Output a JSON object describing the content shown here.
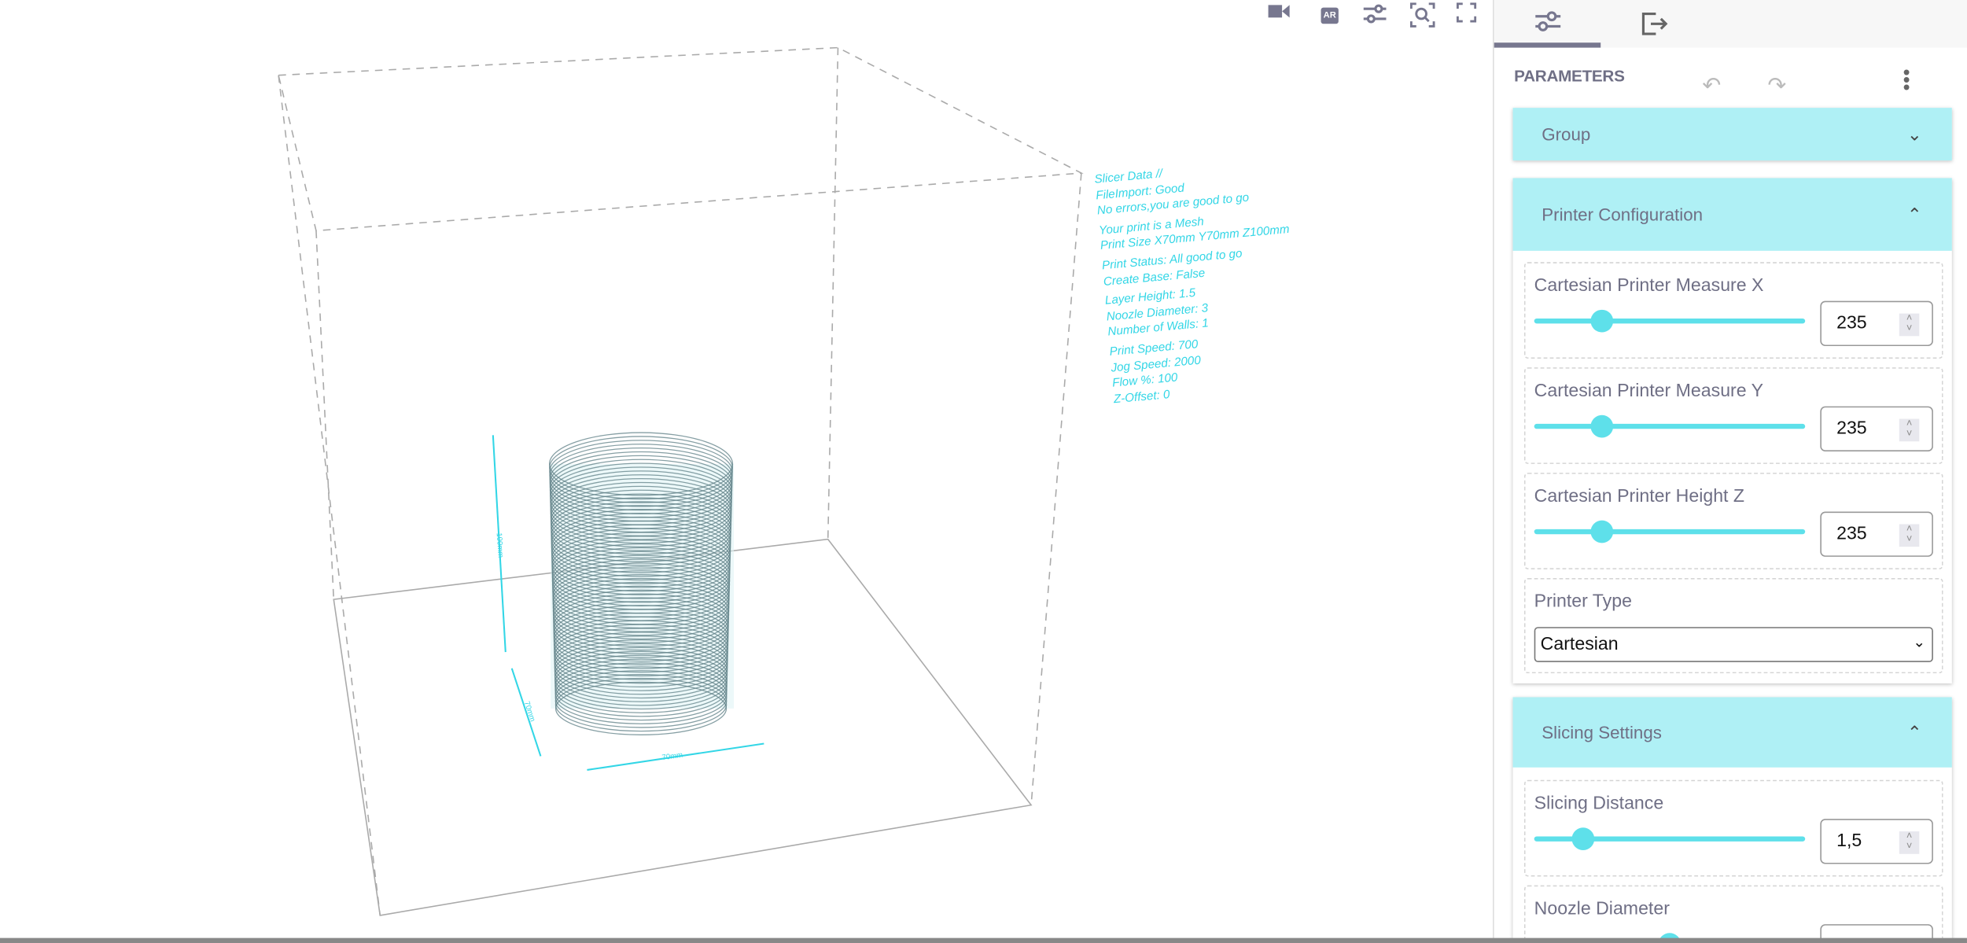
{
  "viewer": {
    "toolbar": [
      {
        "icon": "video-camera-icon"
      },
      {
        "icon": "ar-icon",
        "label": "AR"
      },
      {
        "icon": "sliders-icon"
      },
      {
        "icon": "zoom-fit-icon"
      },
      {
        "icon": "fullscreen-icon"
      }
    ],
    "dimensions": {
      "height": "100mm",
      "depth": "70mm",
      "width": "70mm"
    },
    "slicer_info": [
      "Slicer Data //",
      "FileImport: Good",
      "No errors,you are good to go",
      "Your print is a Mesh",
      "Print Size X70mm Y70mm Z100mm",
      "Print Status: All good to go",
      "Create Base: False",
      "Layer Height: 1.5",
      "Noozle Diameter: 3",
      "Number of Walls: 1",
      "Print Speed: 700",
      "Jog Speed: 2000",
      "Flow %: 100",
      "Z-Offset: 0"
    ],
    "accent_color": "#33d6e6"
  },
  "panel": {
    "tabs": [
      {
        "icon": "sliders-icon",
        "active": true
      },
      {
        "icon": "export-icon",
        "active": false
      }
    ],
    "title": "PARAMETERS",
    "group": {
      "label": "Group"
    },
    "printer_configuration": {
      "label": "Printer Configuration",
      "fields": [
        {
          "label": "Cartesian Printer Measure X",
          "value": "235",
          "slider_fraction": 0.25
        },
        {
          "label": "Cartesian Printer Measure Y",
          "value": "235",
          "slider_fraction": 0.25
        },
        {
          "label": "Cartesian Printer Height Z",
          "value": "235",
          "slider_fraction": 0.25
        }
      ],
      "printer_type": {
        "label": "Printer Type",
        "value": "Cartesian"
      }
    },
    "slicing_settings": {
      "label": "Slicing Settings",
      "fields": [
        {
          "label": "Slicing Distance",
          "value": "1,5",
          "slider_fraction": 0.18
        },
        {
          "label": "Noozle Diameter",
          "value": "",
          "slider_fraction": 0.5
        }
      ]
    },
    "header_color": "#aff0f5",
    "slider_color": "#5ee0ea"
  }
}
